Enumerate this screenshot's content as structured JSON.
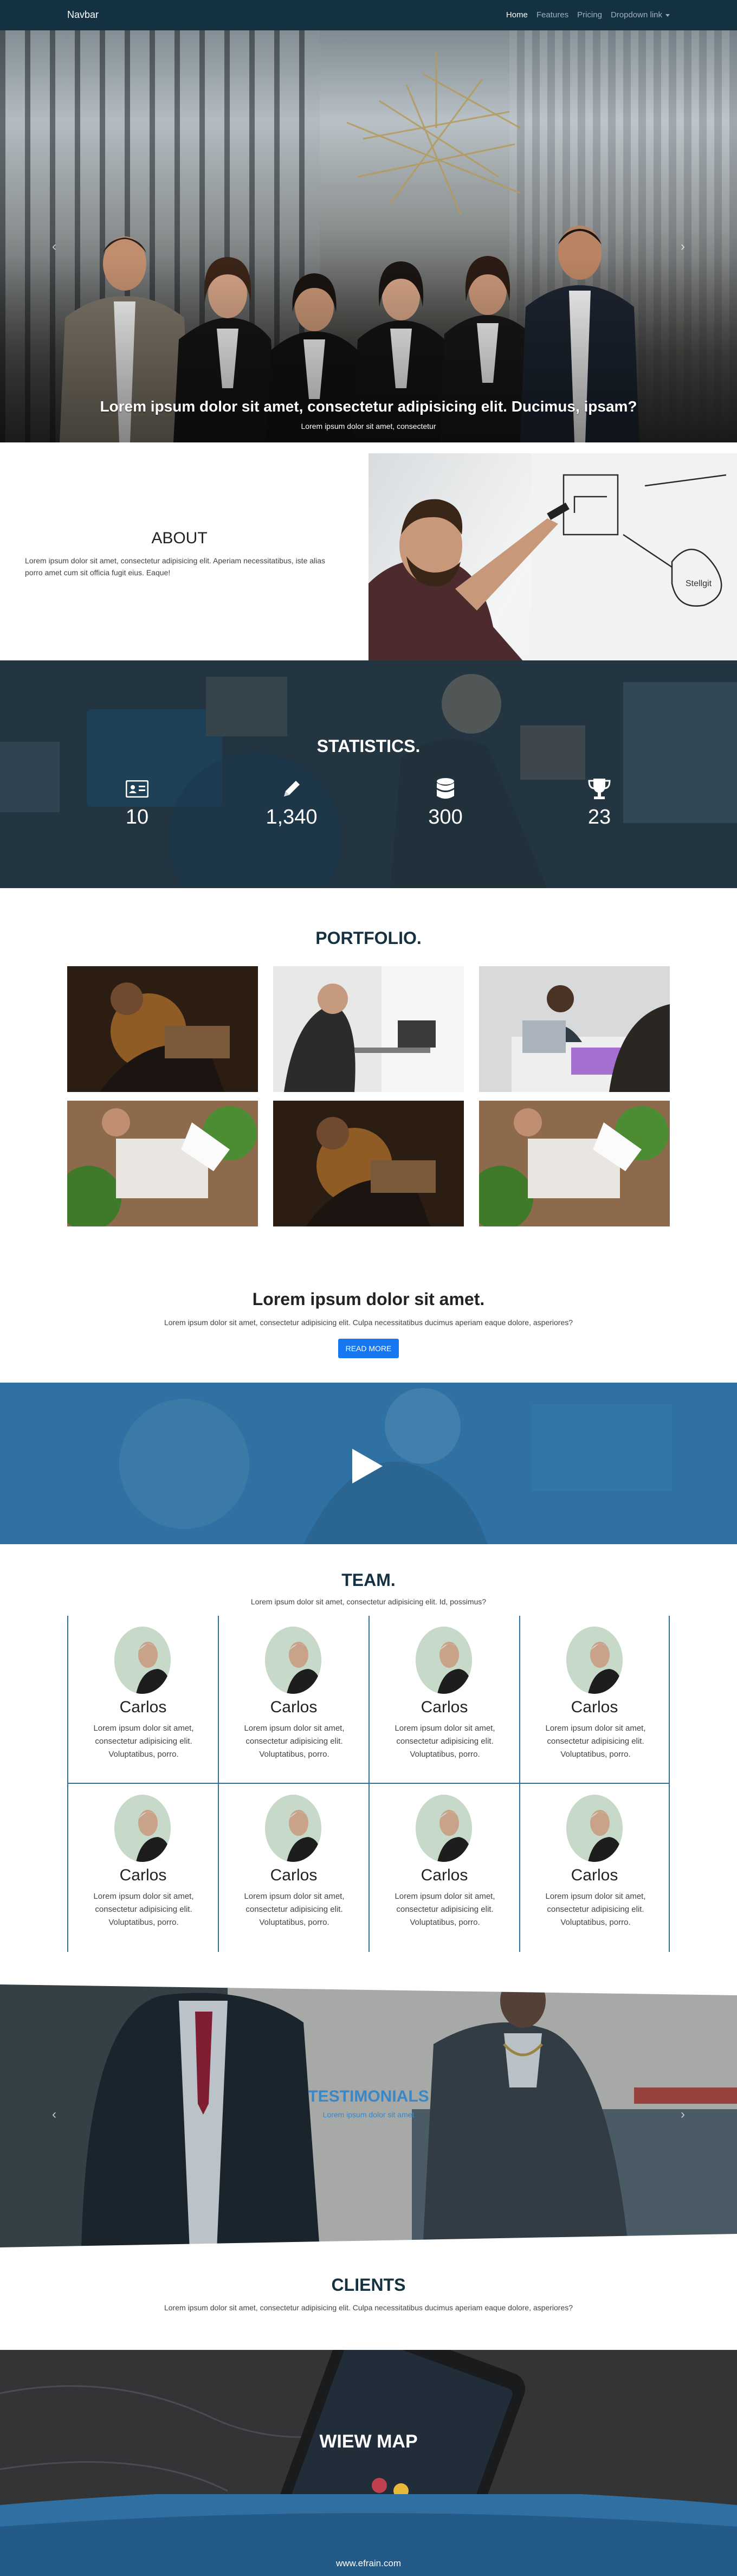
{
  "navbar": {
    "brand": "Navbar",
    "links": [
      "Home",
      "Features",
      "Pricing",
      "Dropdown link"
    ]
  },
  "hero": {
    "heading": "Lorem ipsum dolor sit amet, consectetur adipisicing elit. Ducimus, ipsam?",
    "subheading": "Lorem ipsum dolor sit amet, consectetur",
    "prev_icon": "chevron-left-icon",
    "next_icon": "chevron-right-icon"
  },
  "about": {
    "title": "ABOUT",
    "text": "Lorem ipsum dolor sit amet, consectetur adipisicing elit. Aperiam necessitatibus, iste alias porro amet cum sit officia fugit eius. Eaque!"
  },
  "stats": {
    "title": "STATISTICS.",
    "items": [
      {
        "icon": "id-card-icon",
        "value": "10"
      },
      {
        "icon": "pencil-icon",
        "value": "1,340"
      },
      {
        "icon": "database-icon",
        "value": "300"
      },
      {
        "icon": "trophy-icon",
        "value": "23"
      }
    ]
  },
  "portfolio": {
    "title": "PORTFOLIO."
  },
  "cta": {
    "title": "Lorem ipsum dolor sit amet.",
    "text": "Lorem ipsum dolor sit amet, consectetur adipisicing elit. Culpa necessitatibus ducimus aperiam eaque dolore, asperiores?",
    "button": "READ MORE"
  },
  "video": {
    "play_icon": "play-icon"
  },
  "team": {
    "title": "TEAM.",
    "subtitle": "Lorem ipsum dolor sit amet, consectetur adipisicing elit. Id, possimus?",
    "members": [
      {
        "name": "Carlos",
        "bio": "Lorem ipsum dolor sit amet, consectetur adipisicing elit. Voluptatibus, porro."
      },
      {
        "name": "Carlos",
        "bio": "Lorem ipsum dolor sit amet, consectetur adipisicing elit. Voluptatibus, porro."
      },
      {
        "name": "Carlos",
        "bio": "Lorem ipsum dolor sit amet, consectetur adipisicing elit. Voluptatibus, porro."
      },
      {
        "name": "Carlos",
        "bio": "Lorem ipsum dolor sit amet, consectetur adipisicing elit. Voluptatibus, porro."
      },
      {
        "name": "Carlos",
        "bio": "Lorem ipsum dolor sit amet, consectetur adipisicing elit. Voluptatibus, porro."
      },
      {
        "name": "Carlos",
        "bio": "Lorem ipsum dolor sit amet, consectetur adipisicing elit. Voluptatibus, porro."
      },
      {
        "name": "Carlos",
        "bio": "Lorem ipsum dolor sit amet, consectetur adipisicing elit. Voluptatibus, porro."
      },
      {
        "name": "Carlos",
        "bio": "Lorem ipsum dolor sit amet, consectetur adipisicing elit. Voluptatibus, porro."
      }
    ]
  },
  "testimonials": {
    "title": "TESTIMONIALS",
    "subtitle": "Lorem ipsum dolor sit amet"
  },
  "clients": {
    "title": "CLIENTS",
    "text": "Lorem ipsum dolor sit amet, consectetur adipisicing elit. Culpa necessitatibus ducimus aperiam eaque dolore, asperiores?"
  },
  "map": {
    "title": "WIEW MAP"
  },
  "footer": {
    "link": "www.efrain.com"
  },
  "colors": {
    "navbar_bg": "#143141",
    "accent_blue": "#1677f0",
    "team_border": "#2f6f9d",
    "footer_blue": "#2f6fa2"
  }
}
